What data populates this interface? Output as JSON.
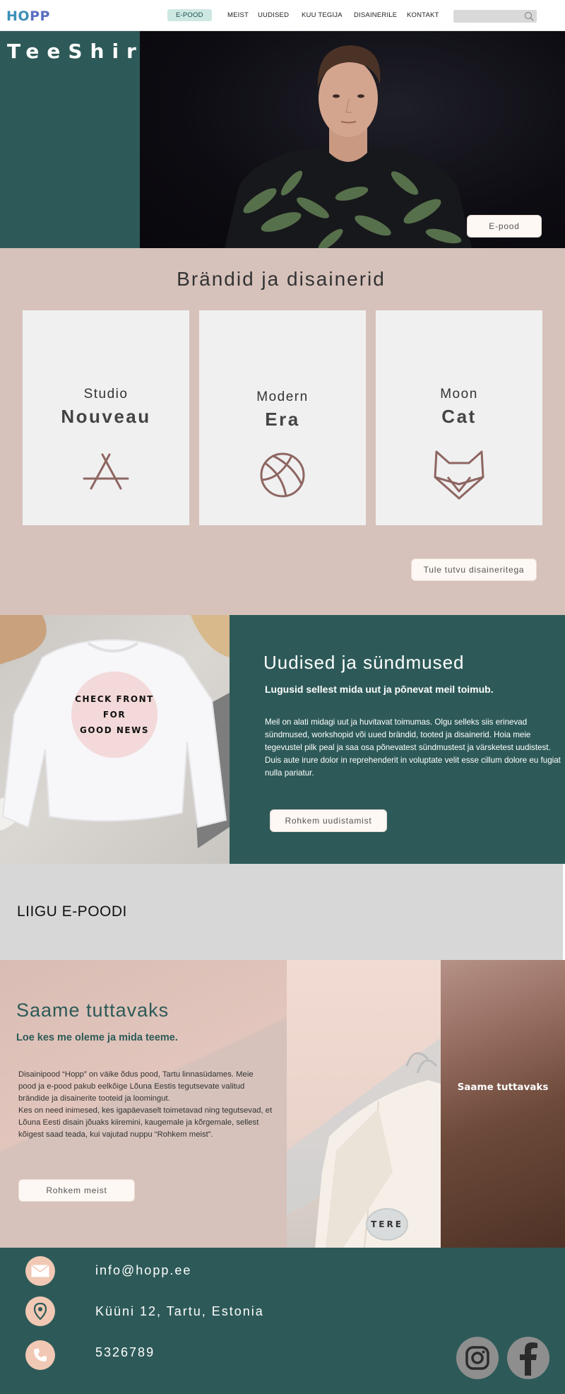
{
  "nav": {
    "logo_part1": "HO",
    "logo_part2": "PP",
    "items": [
      "E-POOD",
      "MEIST",
      "UUDISED",
      "KUU TEGIJA",
      "DISAINERILE",
      "KONTAKT"
    ],
    "search_placeholder": ""
  },
  "hero": {
    "title": "TeeShirt",
    "button": "E-pood"
  },
  "brands": {
    "title": "Brändid ja disainerid",
    "cards": [
      {
        "small": "Studio",
        "big": "Nouveau",
        "icon": "app-store-icon"
      },
      {
        "small": "Modern",
        "big": "Era",
        "icon": "basketball-icon"
      },
      {
        "small": "Moon",
        "big": "Cat",
        "icon": "fox-icon"
      }
    ],
    "button": "Tule tutvu disaineritega"
  },
  "news": {
    "badge": [
      "CHECK FRONT",
      "FOR",
      "GOOD NEWS"
    ],
    "title": "Uudised ja sündmused",
    "subtitle": "Lugusid sellest mida uut ja põnevat meil toimub.",
    "body": "Meil on alati midagi uut ja huvitavat toimumas. Olgu selleks siis erinevad sündmused, workshopid või uued brändid, tooted ja disainerid. Hoia meie tegevustel pilk peal ja saa osa põnevatest sündmustest ja värsketest uudistest. Duis aute irure dolor in reprehenderit in voluptate velit esse cillum dolore eu fugiat nulla pariatur.",
    "button": "Rohkem uudistamist"
  },
  "liigu": {
    "text": "LIIGU E-POODI"
  },
  "about": {
    "title": "Saame tuttavaks",
    "subtitle": "Loe kes me oleme ja mida teeme.",
    "body": "Disainipood “Hopp” on väike õdus pood, Tartu linnasüdames. Meie pood ja e-pood pakub  eelkõige Lõuna Eestis tegutsevate valitud brändide ja disainerite tooteid ja loomingut.\nKes on need inimesed, kes igapäevaselt toimetavad ning tegutsevad, et Lõuna Eesti disain jõuaks kiiremini, kaugemale ja kõrgemale, sellest kõigest saad teada, kui vajutad nuppu “Rohkem meist”.",
    "button": "Rohkem meist",
    "tere": "TERE",
    "right_text": "Saame tuttavaks"
  },
  "footer": {
    "email": "info@hopp.ee",
    "address": "Küüni 12, Tartu, Estonia",
    "phone": "5326789"
  },
  "colors": {
    "teal": "#2d5a58",
    "rose": "#d6c2bb",
    "accent_icon": "#8e6662"
  }
}
